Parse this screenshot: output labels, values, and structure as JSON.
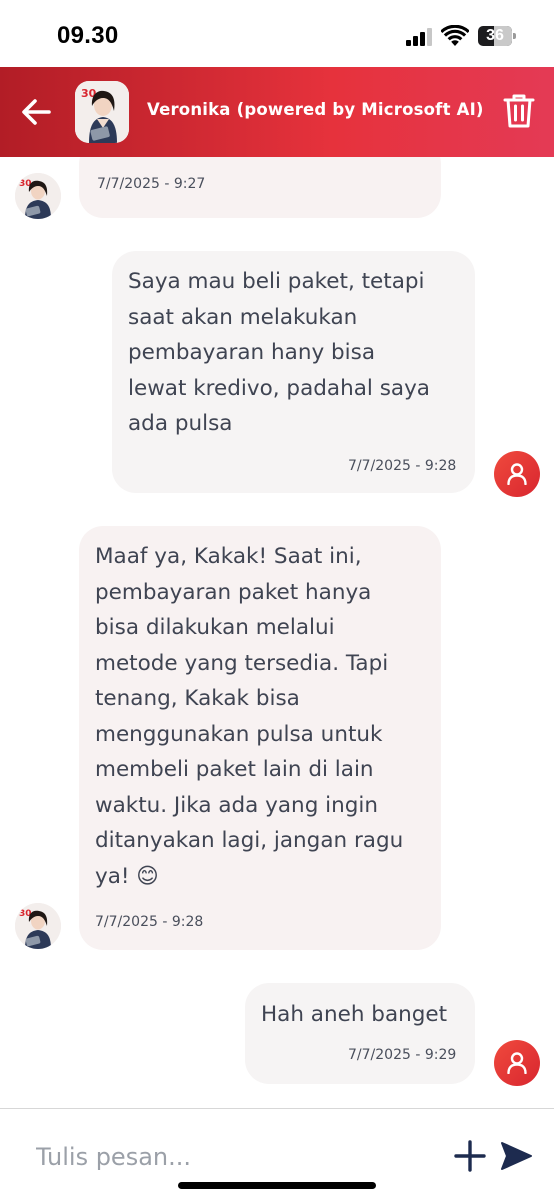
{
  "status_bar": {
    "time": "09.30",
    "battery": "36"
  },
  "header": {
    "title": "Veronika (powered by Microsoft AI)",
    "back_icon": "arrow-left-icon",
    "delete_icon": "trash-icon",
    "color_start": "#b21d26",
    "color_end": "#e43a55"
  },
  "messages": [
    {
      "sender": "bot",
      "text": "",
      "time": "7/7/2025 - 9:27"
    },
    {
      "sender": "user",
      "text": "Saya mau beli paket, tetapi\nsaat akan melakukan\npembayaran hany bisa\nlewat kredivo, padahal saya\nada pulsa",
      "time": "7/7/2025 - 9:28"
    },
    {
      "sender": "bot",
      "text": "Maaf ya, Kakak! Saat ini,\npembayaran paket hanya\nbisa dilakukan melalui\nmetode yang tersedia. Tapi\ntenang, Kakak bisa\nmenggunakan pulsa untuk\nmembeli paket lain di lain\nwaktu. Jika ada yang ingin\nditanyakan lagi, jangan ragu\nya! 😊",
      "time": "7/7/2025 - 9:28"
    },
    {
      "sender": "user",
      "text": "Hah aneh banget",
      "time": "7/7/2025 - 9:29"
    }
  ],
  "composer": {
    "placeholder": "Tulis pesan...",
    "add_icon": "plus-icon",
    "send_icon": "send-icon"
  },
  "colors": {
    "accent_red": "#e6323c",
    "bubble_bg": "#f6f4f4",
    "send_icon": "#1d2b4f"
  }
}
